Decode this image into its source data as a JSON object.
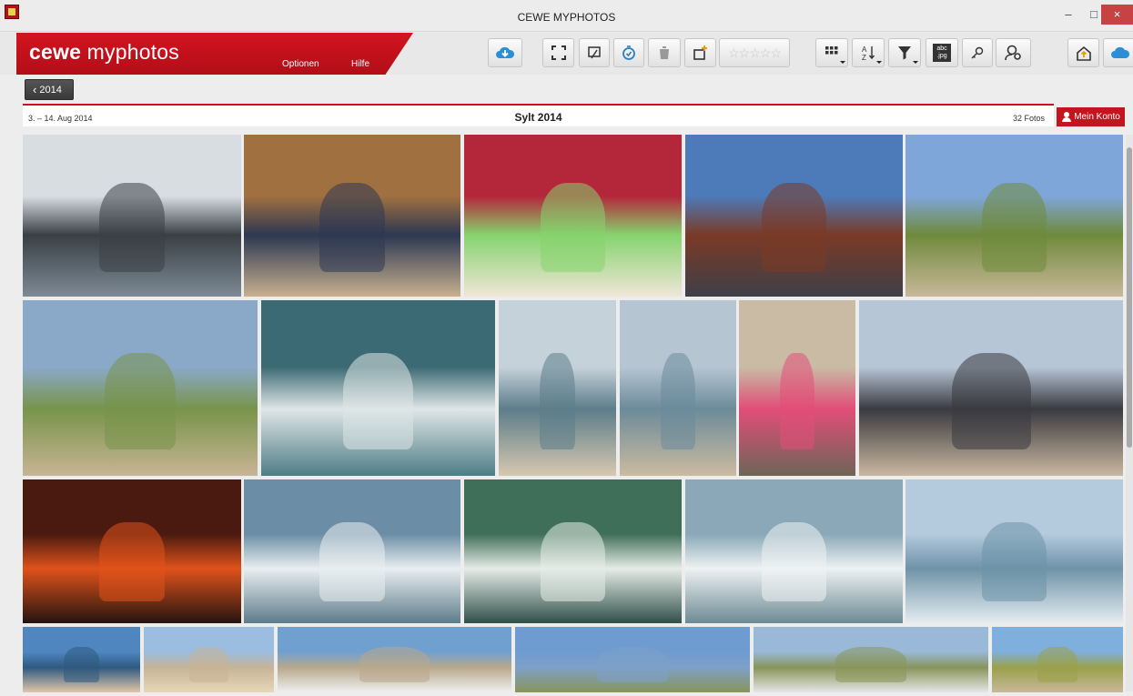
{
  "window": {
    "title": "CEWE MYPHOTOS",
    "controls": [
      "–",
      "□",
      "×"
    ]
  },
  "brand": {
    "logo_bold": "cewe",
    "logo_light": " myphotos",
    "menu": [
      "Optionen",
      "Hilfe"
    ],
    "color": "#c5141e"
  },
  "toolbar": {
    "rating_stars": "☆☆☆☆☆",
    "abc_label": "abc\n.jpg",
    "icons": [
      "cloud-download-icon",
      "fullscreen-icon",
      "slideshow-icon",
      "timer-icon",
      "trash-icon",
      "add-album-icon",
      "rating-stars",
      "grid-view-icon",
      "sort-icon",
      "filter-icon",
      "rename-icon",
      "key-icon",
      "search-person-icon",
      "share-icon",
      "cloud-icon"
    ]
  },
  "nav": {
    "back_label": "2014",
    "back_chevron": "‹"
  },
  "album": {
    "date_range": "3. – 14. Aug 2014",
    "title": "Sylt 2014",
    "photo_count": "32 Fotos"
  },
  "account": {
    "label": "Mein Konto"
  },
  "photos": [
    {
      "name": "car-mirror-photo",
      "colors": [
        "#d8dde2",
        "#3a3f45",
        "#7d8a94"
      ]
    },
    {
      "name": "restaurant-photo",
      "colors": [
        "#a07040",
        "#2d3852",
        "#c8b090"
      ]
    },
    {
      "name": "beach-chair-photo",
      "colors": [
        "#b4263a",
        "#86d36e",
        "#f0e6d8"
      ]
    },
    {
      "name": "beach-bar-evening-photo",
      "colors": [
        "#4d7ab8",
        "#7a3a26",
        "#3f3f48"
      ]
    },
    {
      "name": "beach-volleyball-photo",
      "colors": [
        "#7fa6d8",
        "#6f8a3c",
        "#c9b89a"
      ]
    },
    {
      "name": "volleyball-dunes-photo",
      "colors": [
        "#8aa9c9",
        "#78944a",
        "#c8b496"
      ]
    },
    {
      "name": "bodyboard-wave-photo",
      "colors": [
        "#3c6a74",
        "#dfe6e6",
        "#4d7d86"
      ]
    },
    {
      "name": "surfer-board-photo-1",
      "colors": [
        "#c6d2da",
        "#5c7d8a",
        "#d7c8b0"
      ]
    },
    {
      "name": "surfer-board-photo-2",
      "colors": [
        "#b6c5d2",
        "#6c8b9a",
        "#cbbba0"
      ]
    },
    {
      "name": "woman-sitting-photo",
      "colors": [
        "#c9bba4",
        "#e14e78",
        "#6e6558"
      ]
    },
    {
      "name": "surfer-group-photo",
      "colors": [
        "#b7c6d6",
        "#3a3a40",
        "#c9b8a0"
      ]
    },
    {
      "name": "sunset-photo",
      "colors": [
        "#4a1a10",
        "#e0521a",
        "#241410"
      ]
    },
    {
      "name": "surf-wave-photo-1",
      "colors": [
        "#6b8ea6",
        "#e9eef0",
        "#5d7c8a"
      ]
    },
    {
      "name": "surf-wave-photo-2",
      "colors": [
        "#3f6f58",
        "#e6ece8",
        "#2f4f48"
      ]
    },
    {
      "name": "surf-wave-photo-3",
      "colors": [
        "#8aa8b8",
        "#eef2f2",
        "#6d8a94"
      ]
    },
    {
      "name": "surf-wave-photo-4",
      "colors": [
        "#b4cadd",
        "#6e93a8",
        "#e6edf0"
      ]
    },
    {
      "name": "boy-water-photo",
      "colors": [
        "#4f86c0",
        "#2f5a80",
        "#e2c6a8"
      ]
    },
    {
      "name": "volleyball-sky-photo",
      "colors": [
        "#9bbde0",
        "#c7b496",
        "#e8d6b8"
      ]
    },
    {
      "name": "beach-event-photo",
      "colors": [
        "#6fa0d0",
        "#b8a88c",
        "#f0f0f0"
      ]
    },
    {
      "name": "sky-dunes-photo",
      "colors": [
        "#6e9bd0",
        "#7ea0c8",
        "#88955a"
      ]
    },
    {
      "name": "tents-beach-photo",
      "colors": [
        "#9ab8d8",
        "#88955a",
        "#e6e6e6"
      ]
    },
    {
      "name": "volleyball-net-photo",
      "colors": [
        "#7fb0dd",
        "#9aa04a",
        "#c8b89a"
      ]
    }
  ]
}
